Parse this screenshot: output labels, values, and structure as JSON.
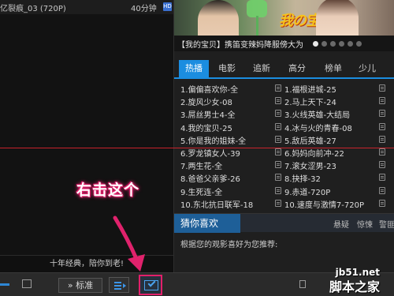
{
  "player": {
    "title": "亿裂痕_03 (720P)",
    "duration": "40分钟",
    "hd_badge": "HD",
    "slogan": "十年经典，陪你到老!"
  },
  "banner": {
    "logo_text": "我の宝贝",
    "caption": "【我的宝贝】携笛变辣妈降服傍大为",
    "dot_count": 6,
    "active_dot": 0
  },
  "tabs": [
    "热播",
    "电影",
    "追新",
    "高分",
    "榜单",
    "少儿"
  ],
  "active_tab": 0,
  "list_left": [
    "1.偏偏喜欢你-全",
    "2.旋风少女-08",
    "3.屌丝男士4-全",
    "4.我的宝贝-25",
    "5.你是我的姐妹-全",
    "6.罗龙镇女人-39",
    "7.两生花-全",
    "8.爸爸父亲爹-26",
    "9.生死连-全",
    "10.东北抗日联军-18"
  ],
  "list_right": [
    "1.福根进城-25",
    "2.马上天下-24",
    "3.火线英雄-大结局",
    "4.冰与火的青春-08",
    "5.敌后英雄-27",
    "6.妈妈向前冲-22",
    "7.滚女涩男-23",
    "8.抉择-32",
    "9.赤道-720P",
    "10.速度与激情7-720P"
  ],
  "guess": {
    "title": "猜你喜欢",
    "tags": [
      "悬疑",
      "惊悚",
      "警匪"
    ],
    "description": "根据您的观影喜好为您推荐:"
  },
  "controls": {
    "standard_label": "» 标准"
  },
  "annotation": {
    "text": "右击这个",
    "color": "#e0226c"
  },
  "watermark": {
    "site": "jb51.net",
    "name": "脚本之家"
  }
}
